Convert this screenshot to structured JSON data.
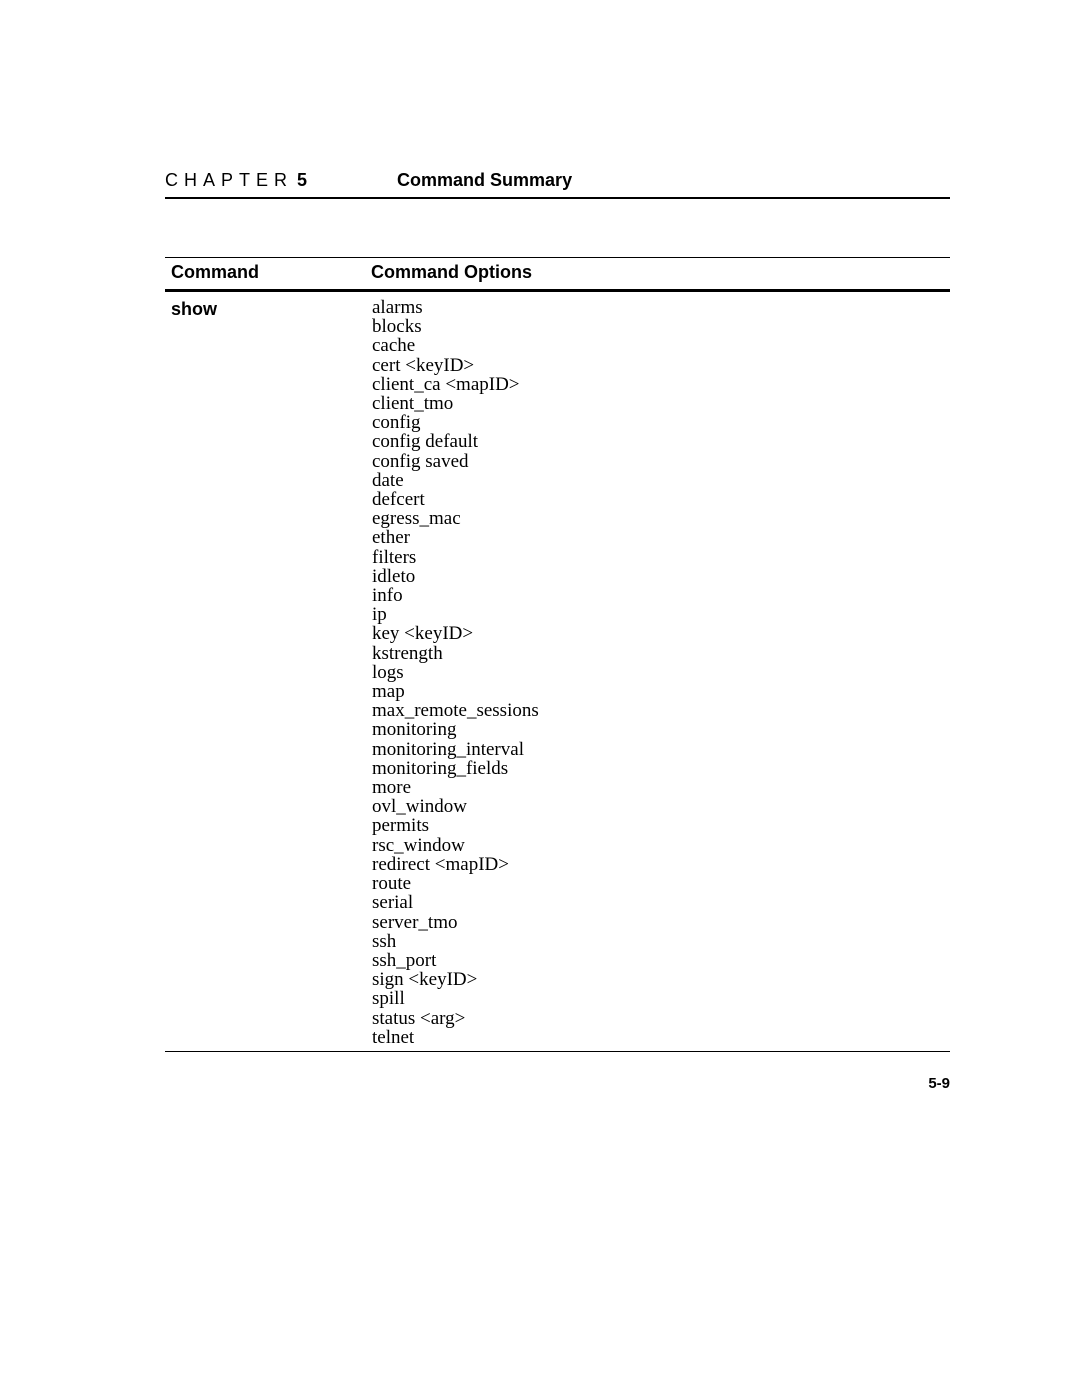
{
  "header": {
    "chapter_label": "CHAPTER",
    "chapter_number": "5",
    "chapter_title": "Command Summary"
  },
  "table": {
    "headers": {
      "command": "Command",
      "options": "Command Options"
    },
    "rows": [
      {
        "command": "show",
        "options": [
          "alarms",
          "blocks",
          "cache",
          "cert  <keyID>",
          "client_ca <mapID>",
          "client_tmo",
          "config",
          "config default",
          "config saved",
          "date",
          "defcert",
          "egress_mac",
          "ether",
          "filters",
          "idleto",
          "info",
          "ip",
          "key <keyID>",
          "kstrength",
          "logs",
          "map",
          "max_remote_sessions",
          "monitoring",
          "monitoring_interval",
          "monitoring_fields",
          "more",
          "ovl_window",
          "permits",
          "rsc_window",
          "redirect <mapID>",
          "route",
          "serial",
          "server_tmo",
          "ssh",
          "ssh_port",
          "sign <keyID>",
          "spill",
          "status <arg>",
          "telnet"
        ]
      }
    ]
  },
  "page_number": "5-9"
}
